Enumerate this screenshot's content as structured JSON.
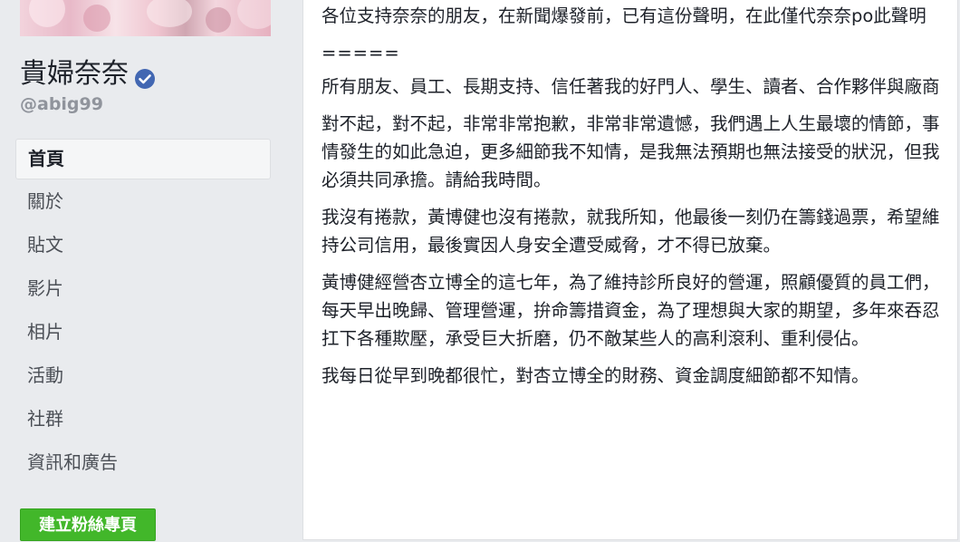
{
  "page": {
    "name": "貴婦奈奈",
    "handle": "@abig99",
    "verified": true
  },
  "nav": [
    {
      "label": "首頁",
      "active": true
    },
    {
      "label": "關於",
      "active": false
    },
    {
      "label": "貼文",
      "active": false
    },
    {
      "label": "影片",
      "active": false
    },
    {
      "label": "相片",
      "active": false
    },
    {
      "label": "活動",
      "active": false
    },
    {
      "label": "社群",
      "active": false
    },
    {
      "label": "資訊和廣告",
      "active": false
    }
  ],
  "create_page_button": "建立粉絲專頁",
  "post": {
    "paragraphs": [
      "各位支持奈奈的朋友，在新聞爆發前，已有這份聲明，在此僅代奈奈po此聲明",
      "=====",
      "所有朋友、員工、長期支持、信任著我的好門人、學生、讀者、合作夥伴與廠商",
      "對不起，對不起，非常非常抱歉，非常非常遺憾，我們遇上人生最壞的情節，事情發生的如此急迫，更多細節我不知情，是我無法預期也無法接受的狀況，但我必須共同承擔。請給我時間。",
      "我沒有捲款，黃博健也沒有捲款，就我所知，他最後一刻仍在籌錢過票，希望維持公司信用，最後實因人身安全遭受威脅，才不得已放棄。",
      "黃博健經營杏立博全的這七年，為了維持診所良好的營運，照顧優質的員工們，每天早出晚歸、管理營運，拚命籌措資金，為了理想與大家的期望，多年來吞忍扛下各種欺壓，承受巨大折磨，仍不敵某些人的高利滾利、重利侵佔。",
      "我每日從早到晚都很忙，對杏立博全的財務、資金調度細節都不知情。"
    ]
  },
  "colors": {
    "background": "#e9ebee",
    "verified_badge": "#4267b2",
    "create_button": "#42b72a",
    "handle_text": "#90949c"
  }
}
